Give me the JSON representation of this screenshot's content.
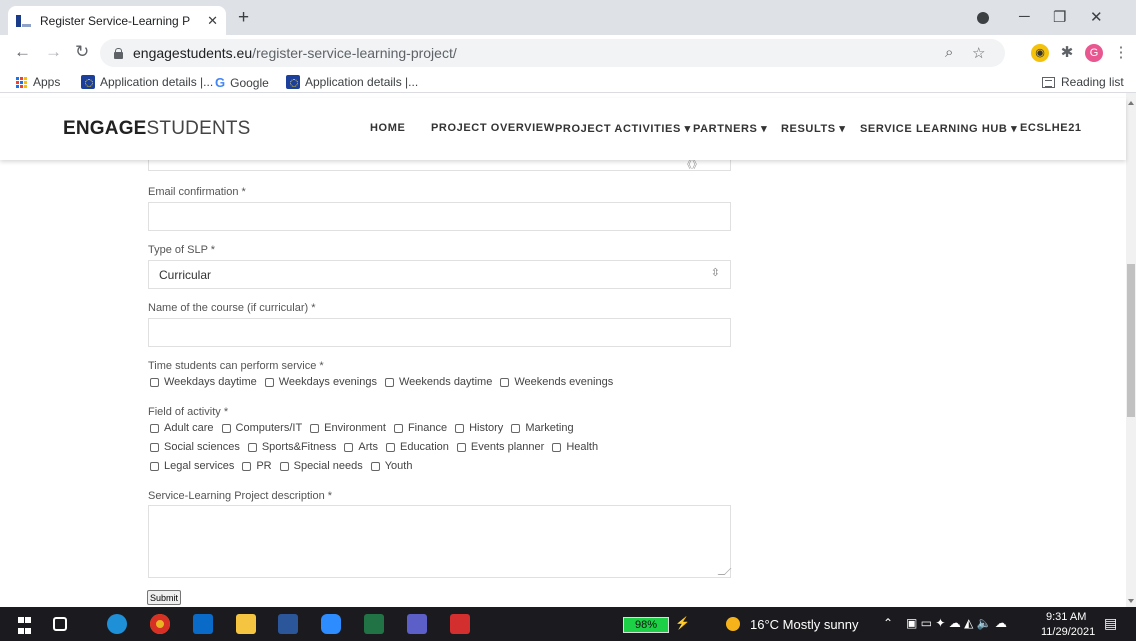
{
  "browser": {
    "tab_title": "Register Service-Learning Project",
    "new_tab_symbol": "+",
    "url_host": "engagestudents.eu",
    "url_path": "/register-service-learning-project/",
    "bookmarks": {
      "apps": "Apps",
      "item1": "Application details |...",
      "item2": "Google",
      "item3": "Application details |...",
      "reading_list": "Reading list"
    },
    "profile_initial": "G"
  },
  "site": {
    "logo_bold": "ENGAGE",
    "logo_light": "STUDENTS",
    "nav": [
      "HOME",
      "PROJECT OVERVIEW",
      "PROJECT ACTIVITIES ▾",
      "PARTNERS ▾",
      "RESULTS ▾",
      "SERVICE LEARNING HUB ▾",
      "ECSLHE21"
    ]
  },
  "form": {
    "email_confirmation_label": "Email confirmation",
    "type_label": "Type of SLP",
    "type_value": "Curricular",
    "course_label": "Name of the course (if curricular)",
    "time_label": "Time students can perform service",
    "time_options": [
      "Weekdays daytime",
      "Weekdays evenings",
      "Weekends daytime",
      "Weekends evenings"
    ],
    "field_label": "Field of activity",
    "field_row1": [
      "Adult care",
      "Computers/IT",
      "Environment",
      "Finance",
      "History",
      "Marketing"
    ],
    "field_row2": [
      "Social sciences",
      "Sports&Fitness",
      "Arts",
      "Education",
      "Events planner",
      "Health"
    ],
    "field_row3": [
      "Legal services",
      "PR",
      "Special needs",
      "Youth"
    ],
    "description_label": "Service-Learning Project description",
    "required_marker": "*",
    "submit_label": "Submit"
  },
  "taskbar": {
    "battery": "98%",
    "weather": "16°C  Mostly sunny",
    "time": "9:31 AM",
    "date": "11/29/2021"
  },
  "colors": {
    "chrome_bg": "#dee1e6",
    "battery_green": "#1cd146",
    "taskbar_bg": "#1b1b1f"
  }
}
